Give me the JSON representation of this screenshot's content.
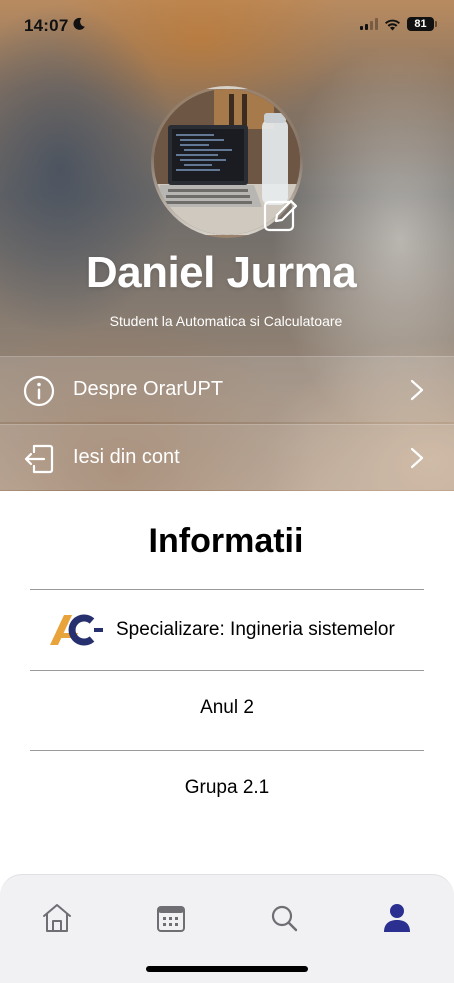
{
  "status_bar": {
    "time": "14:07",
    "battery": "81",
    "icons": [
      "moon-icon",
      "signal-icon",
      "wifi-icon",
      "battery-icon"
    ]
  },
  "profile": {
    "name": "Daniel Jurma",
    "subtitle": "Student la Automatica si Calculatoare",
    "avatar_icon": "avatar-photo",
    "edit_icon": "edit-icon"
  },
  "menu": {
    "items": [
      {
        "label": "Despre OrarUPT",
        "icon": "info-icon"
      },
      {
        "label": "Iesi din cont",
        "icon": "logout-icon"
      }
    ]
  },
  "info": {
    "title": "Informatii",
    "specialization": "Specializare: Ingineria sistemelor",
    "year": "Anul 2",
    "group": "Grupa 2.1",
    "logo_icon": "ac-logo"
  },
  "tabbar": {
    "tabs": [
      {
        "icon": "home-icon",
        "active": false
      },
      {
        "icon": "calendar-icon",
        "active": false
      },
      {
        "icon": "search-icon",
        "active": false
      },
      {
        "icon": "person-icon",
        "active": true
      }
    ],
    "active_color": "#2b2f8f",
    "inactive_color": "#6e6e73"
  },
  "colors": {
    "logo_orange": "#e8a33a",
    "logo_navy": "#27306e"
  }
}
